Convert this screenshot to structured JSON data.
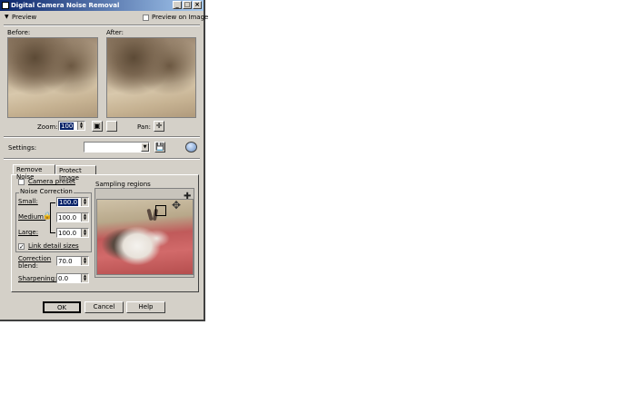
{
  "window": {
    "title": "Digital Camera Noise Removal",
    "min": "_",
    "max": "□",
    "close": "×"
  },
  "preview": {
    "toggle_label": "Preview",
    "on_image_label": "Preview on Image",
    "before_label": "Before:",
    "after_label": "After:"
  },
  "zoom": {
    "label": "Zoom:",
    "value": "100",
    "pan_label": "Pan:"
  },
  "settings": {
    "label": "Settings:",
    "value": ""
  },
  "tabs": [
    {
      "label": "Remove Noise"
    },
    {
      "label": "Protect Image"
    }
  ],
  "remove_noise": {
    "camera_preset_label": "Camera preset",
    "noise_correction_label": "Noise Correction",
    "small_label": "Small:",
    "small_value": "100.0",
    "medium_label": "Medium:",
    "medium_value": "100.0",
    "large_label": "Large:",
    "large_value": "100.0",
    "link_label": "Link detail sizes",
    "link_checked": true,
    "correction_blend_label1": "Correction",
    "correction_blend_label2": "blend:",
    "correction_blend_value": "70.0",
    "sharpening_label": "Sharpening:",
    "sharpening_value": "0.0",
    "sampling_label": "Sampling regions"
  },
  "buttons": {
    "ok": "OK",
    "cancel": "Cancel",
    "help": "Help"
  },
  "icons": {
    "check_mark": "✓",
    "arrow_up": "▲",
    "arrow_down": "▼",
    "pan": "✛",
    "reset": "↺"
  }
}
